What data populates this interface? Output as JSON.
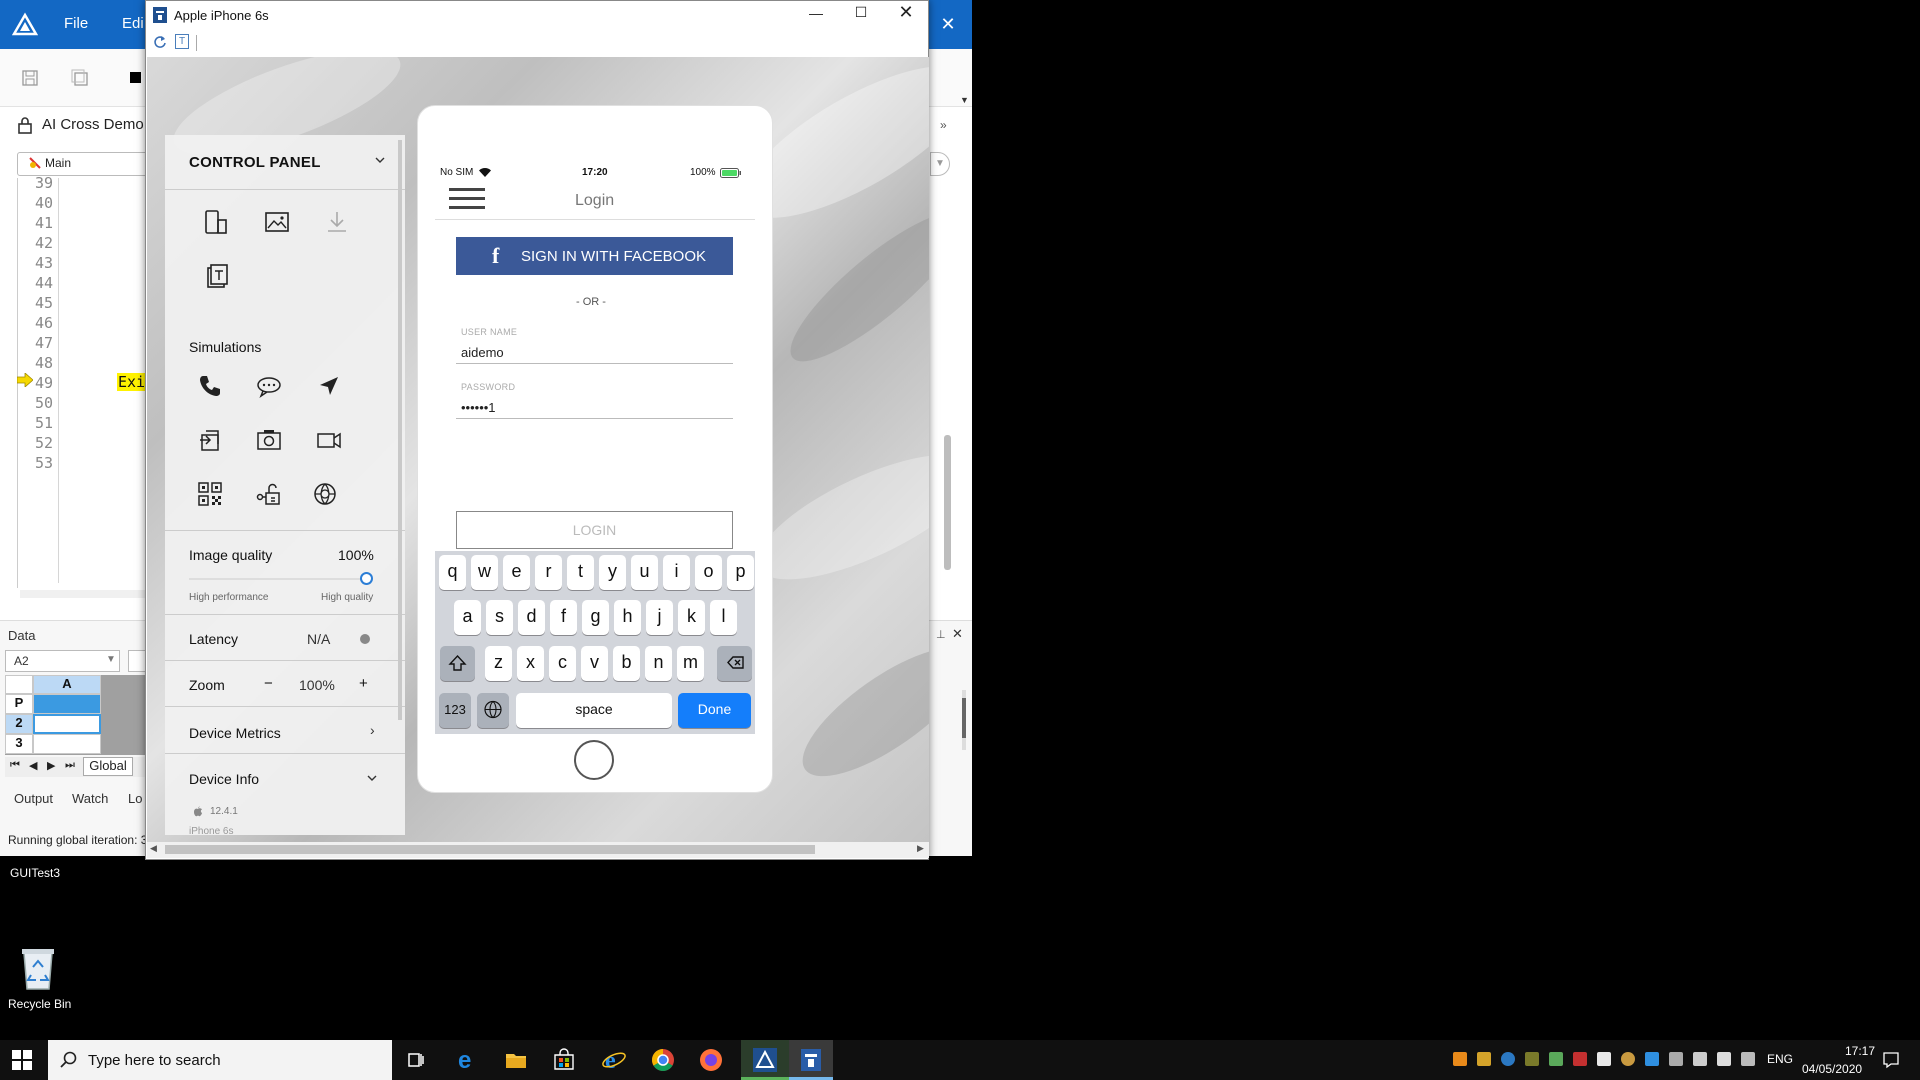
{
  "ide": {
    "menu": {
      "file": "File",
      "edit": "Edi"
    },
    "script_name": "AI Cross Demo",
    "function_combo": "Main",
    "line_numbers": [
      "39",
      "40",
      "41",
      "42",
      "43",
      "44",
      "45",
      "46",
      "47",
      "48",
      "49",
      "50",
      "51",
      "52",
      "53"
    ],
    "current_line_text": "Exi",
    "data_panel": {
      "title": "Data",
      "cell_ref": "A2",
      "column_header": "A",
      "row_headers": [
        "P",
        "2",
        "3"
      ],
      "sheet_tab": "Global"
    },
    "bottom_tabs": [
      "Output",
      "Watch",
      "Lo"
    ],
    "status": "Running global iteration: 3"
  },
  "desktop": {
    "icons": [
      {
        "label": "GUITest3"
      },
      {
        "label": "Recycle Bin",
        "icon": "recycle-bin-icon"
      }
    ]
  },
  "phone_window": {
    "title": "Apple iPhone 6s",
    "controls": {
      "minimize": "—",
      "maximize": "☐",
      "close": "✕"
    }
  },
  "control_panel": {
    "title": "CONTROL PANEL",
    "tool_icons": [
      "device-orientation-icon",
      "screenshot-image-icon",
      "download-icon",
      "clipboard-text-icon"
    ],
    "simulations_title": "Simulations",
    "simulation_icons": [
      "phone-call-icon",
      "sms-chat-icon",
      "location-arrow-icon",
      "app-switch-icon",
      "camera-icon",
      "video-camera-icon",
      "qr-code-icon",
      "network-icon",
      "globe-settings-icon"
    ],
    "image_quality": {
      "label": "Image quality",
      "value": "100%",
      "fraction": 1.0,
      "low_label": "High performance",
      "high_label": "High quality"
    },
    "latency": {
      "label": "Latency",
      "value": "N/A"
    },
    "zoom": {
      "label": "Zoom",
      "minus": "−",
      "value": "100%",
      "plus": "+"
    },
    "device_metrics": {
      "label": "Device Metrics"
    },
    "device_info": {
      "label": "Device Info",
      "os_version": "12.4.1",
      "model": "iPhone 6s"
    }
  },
  "phone": {
    "status_bar": {
      "carrier": "No SIM",
      "time": "17:20",
      "battery": "100%"
    },
    "nav_title": "Login",
    "fb_button": "SIGN IN WITH FACEBOOK",
    "fb_glyph": "f",
    "or_text": "- OR -",
    "username": {
      "label": "USER NAME",
      "value": "aidemo"
    },
    "password": {
      "label": "PASSWORD",
      "value": "••••••1"
    },
    "login_button": "LOGIN",
    "keyboard": {
      "row1": [
        "q",
        "w",
        "e",
        "r",
        "t",
        "y",
        "u",
        "i",
        "o",
        "p"
      ],
      "row2": [
        "a",
        "s",
        "d",
        "f",
        "g",
        "h",
        "j",
        "k",
        "l"
      ],
      "row3": [
        "z",
        "x",
        "c",
        "v",
        "b",
        "n",
        "m"
      ],
      "num_key": "123",
      "space_key": "space",
      "done_key": "Done"
    }
  },
  "taskbar": {
    "search_placeholder": "Type here to search",
    "language": "ENG",
    "time": "17:17",
    "date": "04/05/2020"
  },
  "colors": {
    "ide_titlebar": "#1368c4",
    "facebook": "#3b5998",
    "done_key": "#147efb",
    "slider": "#2c7ed6"
  }
}
